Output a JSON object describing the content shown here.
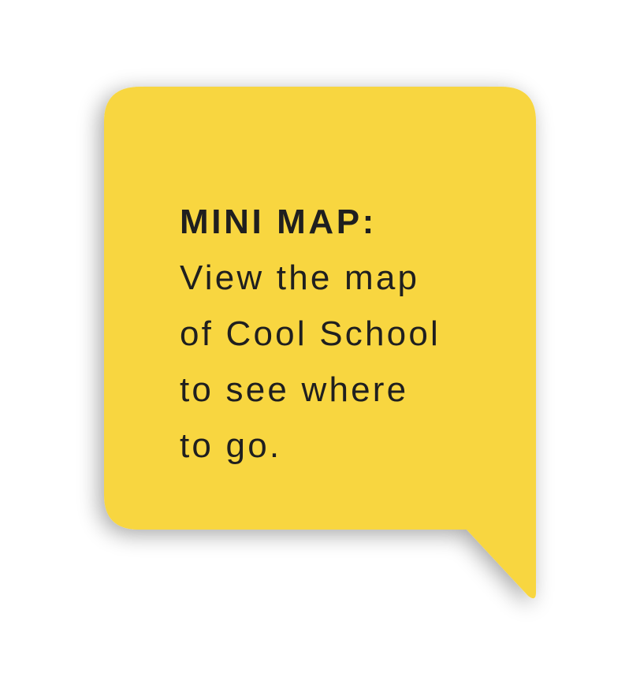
{
  "callout": {
    "heading": "MINI MAP:",
    "body_lines": [
      "View the map",
      "of Cool School",
      "to see where",
      "to go."
    ]
  },
  "colors": {
    "bubble_fill": "#F8D640",
    "text": "#1F1F1F",
    "background": "#FFFFFF"
  }
}
